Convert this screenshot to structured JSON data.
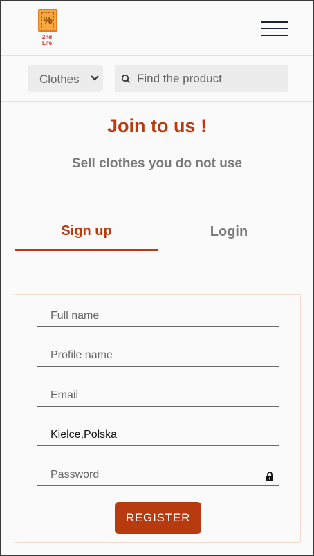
{
  "header": {
    "logo": {
      "symbol": "%",
      "text_line1": "2nd",
      "text_line2": "Life"
    },
    "menu_icon": "hamburger-menu-icon"
  },
  "search_bar": {
    "category_select": {
      "selected": "Clothes"
    },
    "search": {
      "placeholder": "Find the product",
      "value": ""
    }
  },
  "hero": {
    "title": "Join to us !",
    "subtitle": "Sell clothes you do not use"
  },
  "tabs": [
    {
      "label": "Sign up",
      "active": true
    },
    {
      "label": "Login",
      "active": false
    }
  ],
  "register_form": {
    "full_name": {
      "placeholder": "Full name",
      "value": ""
    },
    "profile_name": {
      "placeholder": "Profile name",
      "value": ""
    },
    "email": {
      "placeholder": "Email",
      "value": ""
    },
    "location": {
      "placeholder": "",
      "value": "Kielce,Polska"
    },
    "password": {
      "placeholder": "Password",
      "value": ""
    },
    "submit_label": "REGISTER"
  },
  "colors": {
    "accent": "#b83a0f",
    "muted_text": "#7a7a7a",
    "background": "#fafafa",
    "input_background": "#ececec"
  }
}
